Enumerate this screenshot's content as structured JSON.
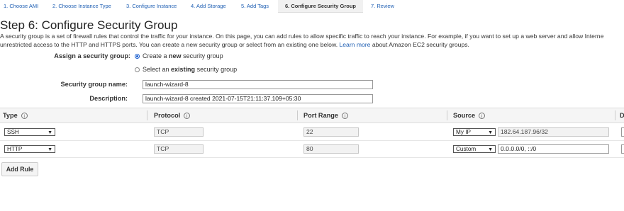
{
  "tabs": [
    {
      "label": "1. Choose AMI"
    },
    {
      "label": "2. Choose Instance Type"
    },
    {
      "label": "3. Configure Instance"
    },
    {
      "label": "4. Add Storage"
    },
    {
      "label": "5. Add Tags"
    },
    {
      "label": "6. Configure Security Group",
      "active": true
    },
    {
      "label": "7. Review"
    }
  ],
  "page_title": "Step 6: Configure Security Group",
  "intro": {
    "line1": "A security group is a set of firewall rules that control the traffic for your instance. On this page, you can add rules to allow specific traffic to reach your instance. For example, if you want to set up a web server and allow Interne",
    "line2_pre": "unrestricted access to the HTTP and HTTPS ports. You can create a new security group or select from an existing one below.",
    "learn_more": "Learn more",
    "line2_post": "about Amazon EC2 security groups."
  },
  "assign": {
    "label": "Assign a security group:",
    "option_new_pre": "Create a",
    "option_new_bold": "new",
    "option_new_post": "security group",
    "option_existing_pre": "Select an",
    "option_existing_bold": "existing",
    "option_existing_post": "security group",
    "selected": "new"
  },
  "sg_name": {
    "label": "Security group name:",
    "value": "launch-wizard-8"
  },
  "description": {
    "label": "Description:",
    "value": "launch-wizard-8 created 2021-07-15T21:11:37.109+05:30"
  },
  "table": {
    "headers": {
      "type": "Type",
      "protocol": "Protocol",
      "port_range": "Port Range",
      "source": "Source",
      "desc": "D"
    },
    "info_glyph": "i",
    "rows": [
      {
        "type": "SSH",
        "protocol": "TCP",
        "port": "22",
        "source_mode": "My IP",
        "source_value": "182.64.187.96/32",
        "source_editable": false
      },
      {
        "type": "HTTP",
        "protocol": "TCP",
        "port": "80",
        "source_mode": "Custom",
        "source_value": "0.0.0.0/0, ::/0",
        "source_editable": true
      }
    ]
  },
  "add_rule_label": "Add Rule",
  "colors": {
    "link": "#1f5fb3",
    "radio_selected": "#1a5fd0",
    "header_bg": "#f5f5f5"
  },
  "icons": {
    "dropdown": "chevron-down-icon",
    "info": "info-icon"
  }
}
